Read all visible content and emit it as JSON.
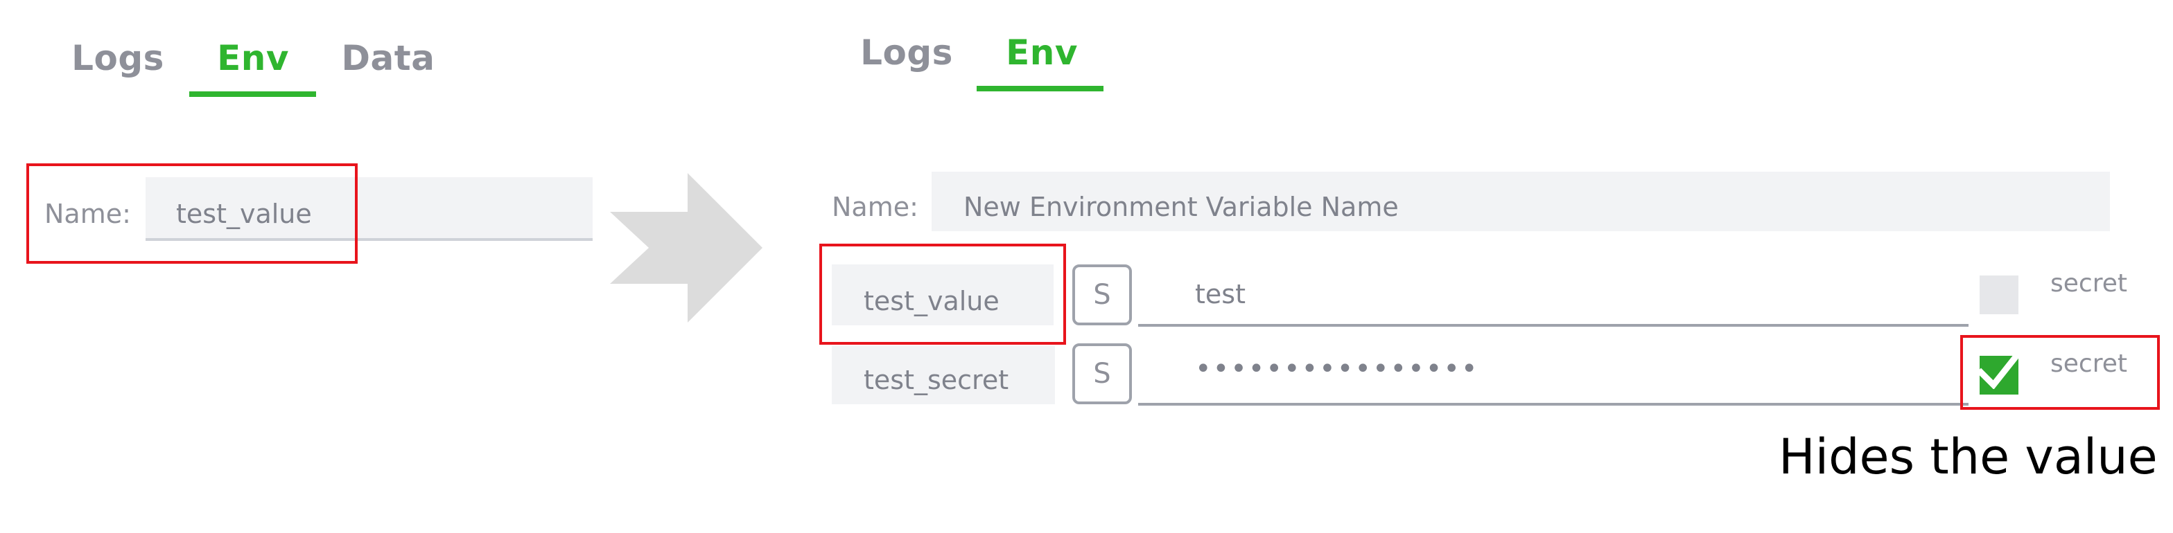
{
  "before": {
    "tabs": [
      {
        "label": "Logs",
        "active": false
      },
      {
        "label": "Env",
        "active": true
      },
      {
        "label": "Data",
        "active": false
      }
    ],
    "name_label": "Name:",
    "name_value": "test_value"
  },
  "after": {
    "tabs": [
      {
        "label": "Logs",
        "active": false
      },
      {
        "label": "Env",
        "active": true
      }
    ],
    "name_label": "Name:",
    "name_placeholder": "New Environment Variable Name",
    "variables": [
      {
        "name": "test_value",
        "type_button": "S",
        "value": "test",
        "secret": false,
        "secret_label": "secret"
      },
      {
        "name": "test_secret",
        "type_button": "S",
        "value": "••••••••••••••••",
        "secret": true,
        "secret_label": "secret"
      }
    ]
  },
  "annotation": {
    "caption": "Hides the value"
  },
  "colors": {
    "accent": "#2fb52f",
    "highlight": "#e8141c",
    "arrow": "#dcdcdc"
  },
  "icons": {
    "transition": "right-arrow-icon",
    "checked": "checkmark-icon"
  }
}
